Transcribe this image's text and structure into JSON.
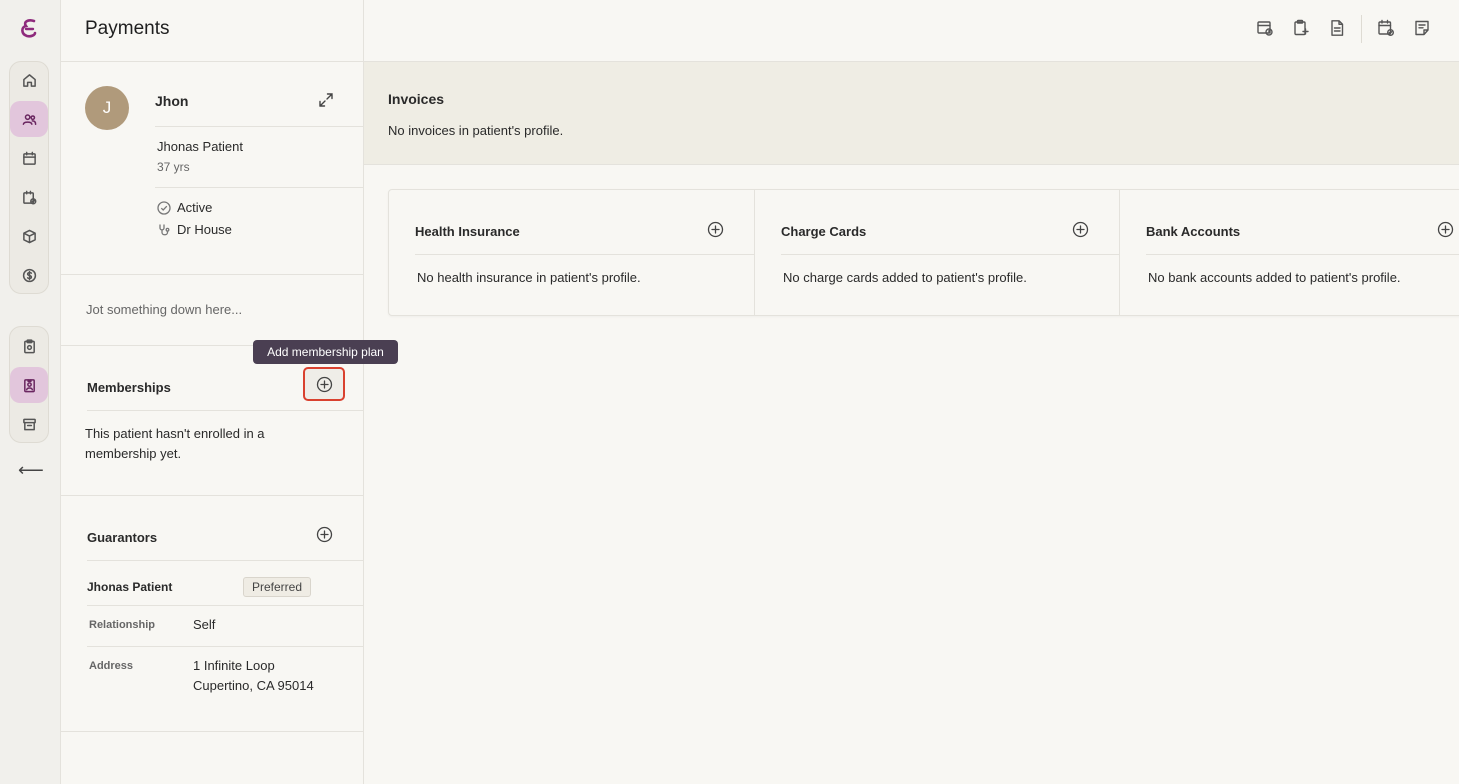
{
  "rail": {
    "items": [
      {
        "name": "home-icon"
      },
      {
        "name": "patients-icon",
        "active": true
      },
      {
        "name": "calendar-icon"
      },
      {
        "name": "calendar-check-icon"
      },
      {
        "name": "box-icon"
      },
      {
        "name": "dollar-icon"
      },
      {
        "name": "clipboard-icon"
      },
      {
        "name": "badge-icon",
        "active": true
      },
      {
        "name": "archive-icon"
      }
    ],
    "back_label": "⟵"
  },
  "panel": {
    "title": "Payments",
    "patient": {
      "initial": "J",
      "name": "Jhon",
      "full_name": "Jhonas Patient",
      "age": "37 yrs",
      "status": "Active",
      "provider": "Dr House"
    },
    "note_placeholder": "Jot something down here...",
    "memberships": {
      "title": "Memberships",
      "tooltip": "Add membership plan",
      "empty": "This patient hasn't enrolled in a membership yet."
    },
    "guarantors": {
      "title": "Guarantors",
      "name": "Jhonas Patient",
      "badge": "Preferred",
      "relationship_label": "Relationship",
      "relationship_value": "Self",
      "address_label": "Address",
      "address_line1": "1 Infinite Loop",
      "address_line2": "Cupertino, CA 95014"
    }
  },
  "main": {
    "invoices": {
      "title": "Invoices",
      "empty": "No invoices in patient's profile."
    },
    "cards": [
      {
        "title": "Health Insurance",
        "empty": "No health insurance in patient's profile."
      },
      {
        "title": "Charge Cards",
        "empty": "No charge cards added to patient's profile."
      },
      {
        "title": "Bank Accounts",
        "empty": "No bank accounts added to patient's profile."
      }
    ]
  },
  "colors": {
    "accent": "#6a2660",
    "active_bg": "#e2c6dc",
    "tooltip_bg": "#4a3f52",
    "focus_ring": "#d9412f",
    "avatar": "#b09a7b"
  }
}
